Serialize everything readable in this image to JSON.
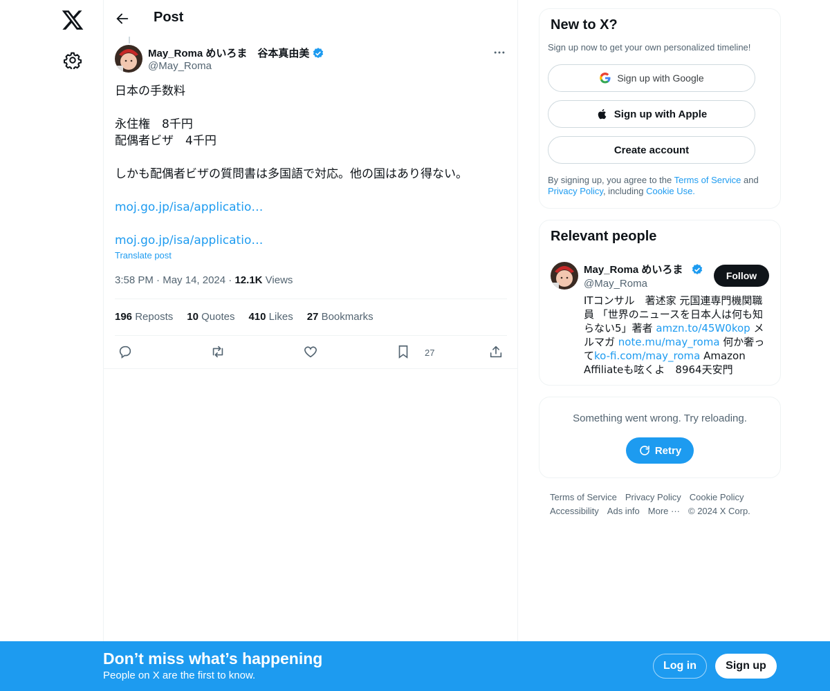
{
  "colors": {
    "accent": "#1d9bf0",
    "text": "#0f1419",
    "secondary": "#536471",
    "border": "#eff3f4"
  },
  "nav": {
    "logo_icon": "x-logo-icon",
    "settings_icon": "gear-icon"
  },
  "header": {
    "title": "Post",
    "back_icon": "arrow-left-icon"
  },
  "post": {
    "author_name": "May_Roma めいろま　谷本真由美",
    "author_handle": "@May_Roma",
    "lines": [
      "日本の手数料",
      "",
      "永住権　8千円",
      "配偶者ビザ　4千円",
      "",
      "しかも配偶者ビザの質問書は多国語で対応。他の国はあり得ない。"
    ],
    "link1": "moj.go.jp/isa/applicatio…",
    "link2": "moj.go.jp/isa/applicatio…",
    "translate": "Translate post",
    "time": "3:58 PM",
    "date": "May 14, 2024",
    "views_count": "12.1K",
    "views_label": "Views",
    "stats": {
      "reposts_count": "196",
      "reposts_label": "Reposts",
      "quotes_count": "10",
      "quotes_label": "Quotes",
      "likes_count": "410",
      "likes_label": "Likes",
      "bookmarks_count": "27",
      "bookmarks_label": "Bookmarks"
    },
    "actions": {
      "bookmark_count": "27"
    }
  },
  "signup_card": {
    "title": "New to X?",
    "subtitle": "Sign up now to get your own personalized timeline!",
    "google": "Sign up with Google",
    "apple": "Sign up with Apple",
    "create": "Create account",
    "legal_prefix": "By signing up, you agree to the ",
    "terms": "Terms of Service",
    "and": " and ",
    "privacy": "Privacy Policy",
    "including": ", including ",
    "cookie": "Cookie Use."
  },
  "relevant": {
    "title": "Relevant people",
    "name": "May_Roma めいろま",
    "handle": "@May_Roma",
    "follow": "Follow",
    "bio_1": "ITコンサル　著述家 元国連専門機関職員 「世界のニュースを日本人は何も知らない5」著者 ",
    "bio_link1": "amzn.to/45W0kop",
    "bio_2": " メルマガ ",
    "bio_link2": "note.mu/may_roma",
    "bio_3": " 何か奢って",
    "bio_link3": "ko-fi.com/may_roma",
    "bio_4": " Amazon Affiliateも呟くよ　8964天安門"
  },
  "error_card": {
    "message": "Something went wrong. Try reloading.",
    "retry": "Retry"
  },
  "footer": {
    "terms": "Terms of Service",
    "privacy": "Privacy Policy",
    "cookie": "Cookie Policy",
    "accessibility": "Accessibility",
    "ads": "Ads info",
    "more": "More ···",
    "copyright": "© 2024 X Corp."
  },
  "banner": {
    "title": "Don’t miss what’s happening",
    "subtitle": "People on X are the first to know.",
    "login": "Log in",
    "signup": "Sign up"
  }
}
